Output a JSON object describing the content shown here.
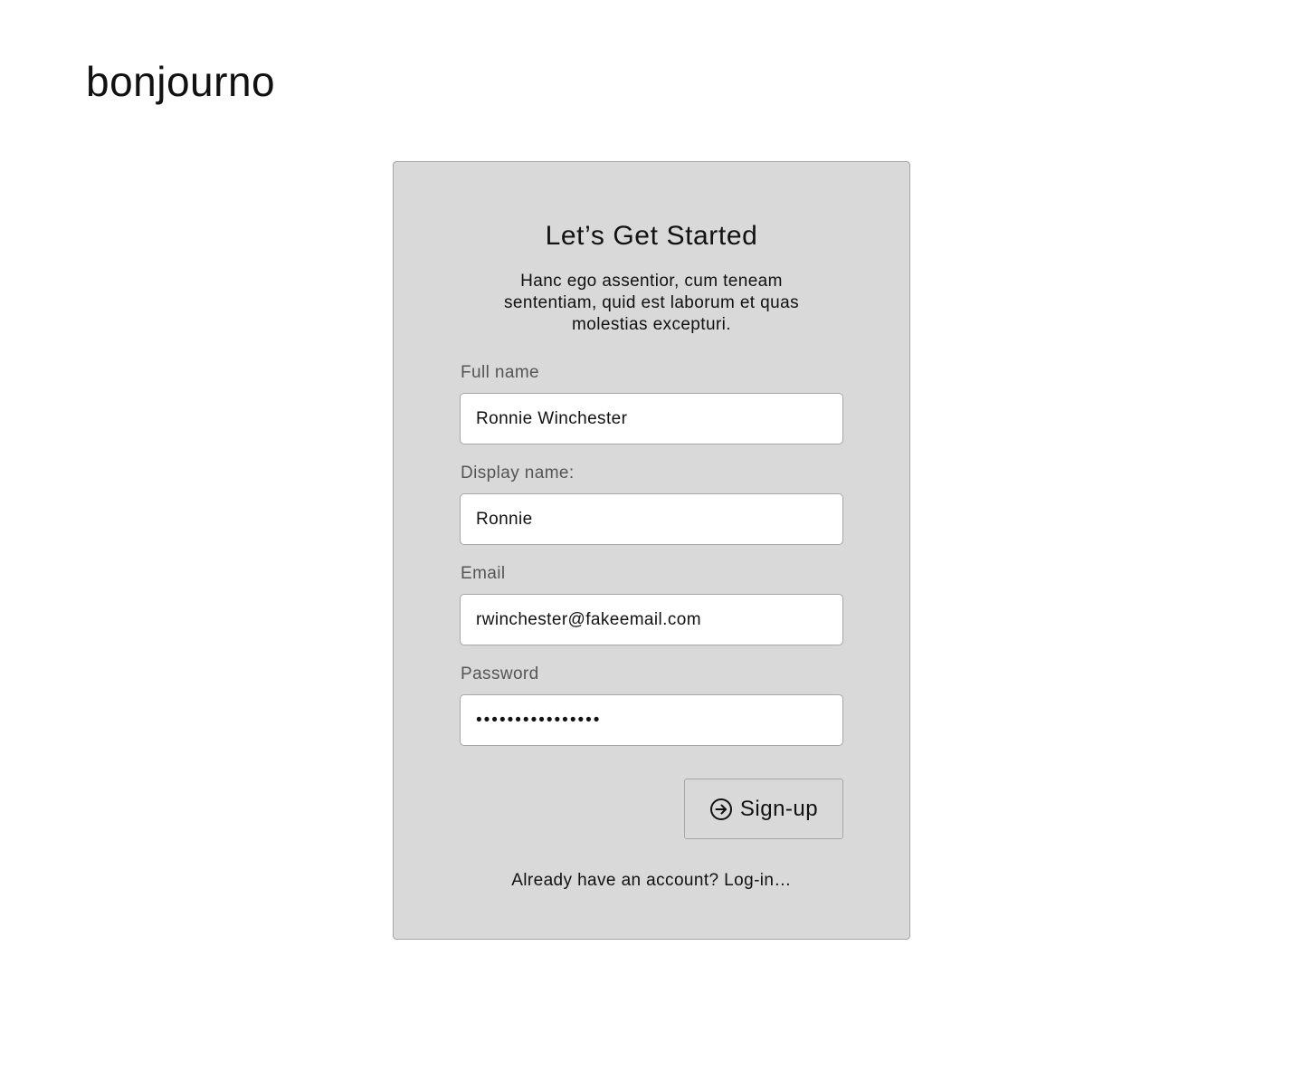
{
  "brand": {
    "logo_text": "bonjourno"
  },
  "signup_card": {
    "title": "Let’s Get Started",
    "description": "Hanc ego assentior, cum teneam sententiam, quid est laborum et quas molestias excepturi.",
    "fields": {
      "full_name": {
        "label": "Full name",
        "value": "Ronnie Winchester"
      },
      "display_name": {
        "label": "Display name:",
        "value": "Ronnie"
      },
      "email": {
        "label": "Email",
        "value": "rwinchester@fakeemail.com"
      },
      "password": {
        "label": "Password",
        "value": "••••••••••••••••"
      }
    },
    "signup_button": {
      "label": "Sign-up",
      "icon": "arrow-circle-right-icon"
    },
    "login_prompt": "Already have an account? Log-in…"
  },
  "colors": {
    "card_background": "#d9d9d9",
    "card_border": "#a6a6a6",
    "input_background": "#ffffff",
    "label_text": "#555555",
    "text": "#111111"
  }
}
